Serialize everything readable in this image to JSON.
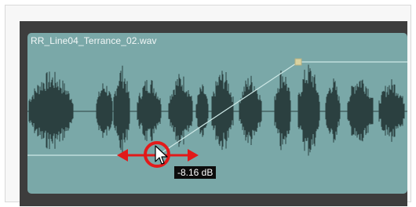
{
  "clip": {
    "name": "RR_Line04_Terrance_02.wav"
  },
  "volume_tooltip": {
    "text": "-8.16 dB"
  },
  "colors": {
    "clip_background": "#7aa8a8",
    "waveform": "#2b4040",
    "envelope_line": "#cde8e6",
    "keyframe": "#d9d2a0",
    "highlight_ring": "#e21a1a",
    "track_border": "#3d3d3d"
  },
  "icons": {
    "cursor": "mouse-pointer-icon",
    "drag_arrows": "horizontal-drag-arrows-icon",
    "keyframe": "square-keyframe-icon"
  }
}
